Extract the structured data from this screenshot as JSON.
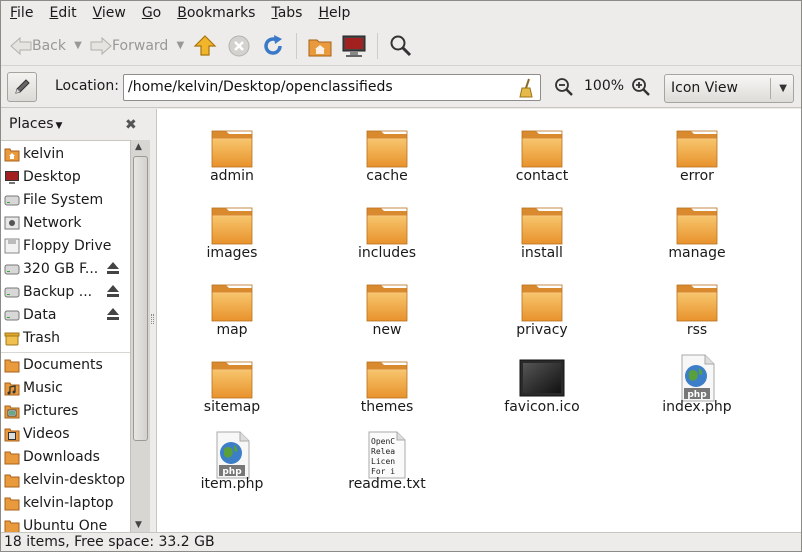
{
  "menubar": {
    "items": [
      {
        "mnemonic": "F",
        "rest": "ile"
      },
      {
        "mnemonic": "E",
        "rest": "dit"
      },
      {
        "mnemonic": "V",
        "rest": "iew"
      },
      {
        "mnemonic": "G",
        "rest": "o"
      },
      {
        "mnemonic": "B",
        "rest": "ookmarks"
      },
      {
        "mnemonic": "T",
        "rest": "abs"
      },
      {
        "mnemonic": "H",
        "rest": "elp"
      }
    ]
  },
  "toolbar": {
    "back_label": "Back",
    "forward_label": "Forward",
    "icons": [
      "home-icon",
      "stop-icon",
      "reload-icon",
      "home-folder-icon",
      "computer-icon",
      "search-icon"
    ]
  },
  "location": {
    "label": "Location:",
    "path": "/home/kelvin/Desktop/openclassifieds",
    "zoom": "100%",
    "view_mode": "Icon View"
  },
  "sidebar": {
    "header": "Places",
    "items": [
      {
        "label": "kelvin",
        "icon": "home-folder-icon"
      },
      {
        "label": "Desktop",
        "icon": "desktop-icon"
      },
      {
        "label": "File System",
        "icon": "drive-icon"
      },
      {
        "label": "Network",
        "icon": "network-icon"
      },
      {
        "label": "Floppy Drive",
        "icon": "floppy-icon"
      },
      {
        "label": "320 GB F...",
        "icon": "drive-icon",
        "eject": true
      },
      {
        "label": "Backup ...",
        "icon": "drive-icon",
        "eject": true
      },
      {
        "label": "Data",
        "icon": "drive-icon",
        "eject": true
      },
      {
        "label": "Trash",
        "icon": "trash-icon"
      },
      {
        "label": "Documents",
        "icon": "folder-icon"
      },
      {
        "label": "Music",
        "icon": "music-folder-icon"
      },
      {
        "label": "Pictures",
        "icon": "pictures-folder-icon"
      },
      {
        "label": "Videos",
        "icon": "videos-folder-icon"
      },
      {
        "label": "Downloads",
        "icon": "folder-icon"
      },
      {
        "label": "kelvin-desktop",
        "icon": "folder-icon"
      },
      {
        "label": "kelvin-laptop",
        "icon": "folder-icon"
      },
      {
        "label": "Ubuntu One",
        "icon": "folder-icon"
      }
    ]
  },
  "files": [
    {
      "name": "admin",
      "type": "folder"
    },
    {
      "name": "cache",
      "type": "folder"
    },
    {
      "name": "contact",
      "type": "folder"
    },
    {
      "name": "error",
      "type": "folder"
    },
    {
      "name": "images",
      "type": "folder"
    },
    {
      "name": "includes",
      "type": "folder"
    },
    {
      "name": "install",
      "type": "folder"
    },
    {
      "name": "manage",
      "type": "folder"
    },
    {
      "name": "map",
      "type": "folder"
    },
    {
      "name": "new",
      "type": "folder"
    },
    {
      "name": "privacy",
      "type": "folder"
    },
    {
      "name": "rss",
      "type": "folder"
    },
    {
      "name": "sitemap",
      "type": "folder"
    },
    {
      "name": "themes",
      "type": "folder"
    },
    {
      "name": "favicon.ico",
      "type": "image"
    },
    {
      "name": "index.php",
      "type": "php"
    },
    {
      "name": "item.php",
      "type": "php"
    },
    {
      "name": "readme.txt",
      "type": "text",
      "preview": [
        "OpenC",
        "Relea",
        "Licen",
        "For i"
      ]
    }
  ],
  "php_badge": "php",
  "status": "18 items, Free space: 33.2 GB"
}
